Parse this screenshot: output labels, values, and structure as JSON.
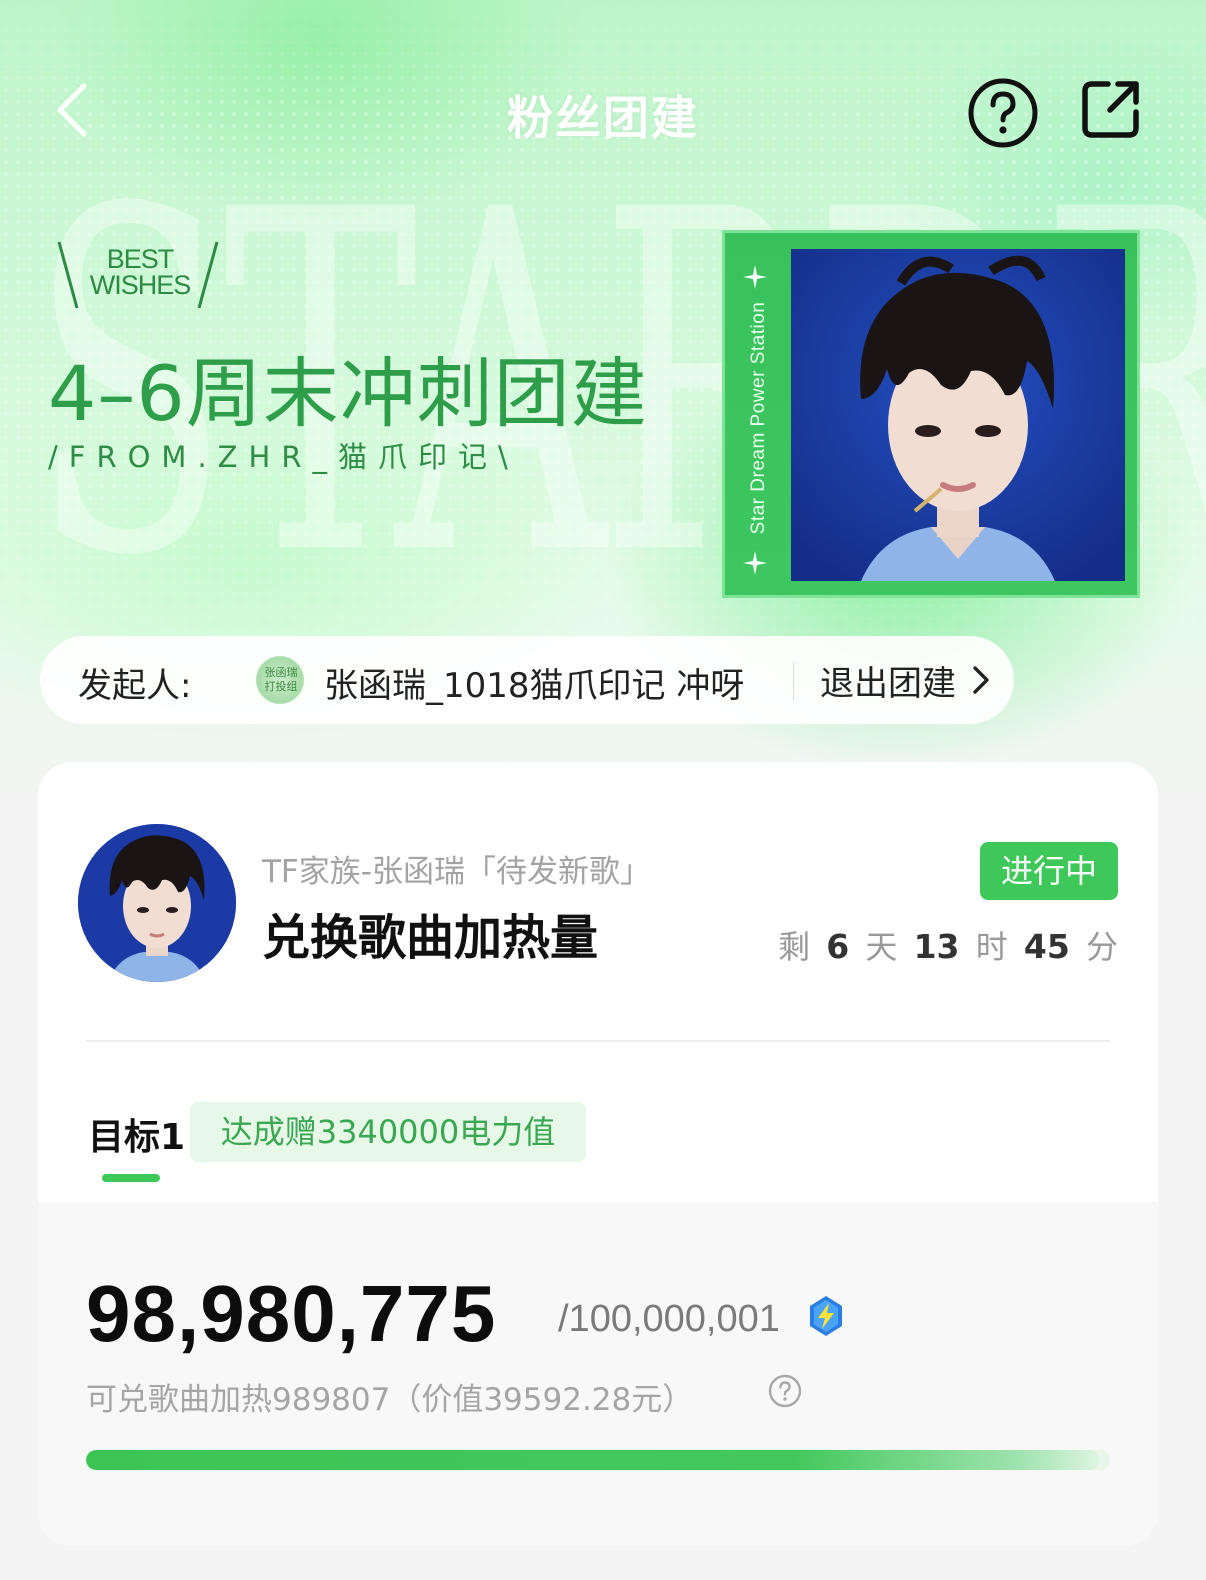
{
  "nav": {
    "title": "粉丝团建"
  },
  "hero": {
    "badge_line1": "BEST",
    "badge_line2": "WISHES",
    "watermark": "STARDREAM",
    "event_title": "4–6周末冲刺团建",
    "event_subtitle": "/FROM.ZHR_猫爪印记\\",
    "photo_label": "Star Dream Power Station"
  },
  "initiator": {
    "label": "发起人:",
    "avatar_text_line1": "张函瑞",
    "avatar_text_line2": "打投组",
    "name": "张函瑞_1018猫爪印记 冲呀",
    "exit_label": "退出团建"
  },
  "task": {
    "artist": "TF家族-张函瑞「待发新歌」",
    "title": "兑换歌曲加热量",
    "status": "进行中",
    "countdown": {
      "prefix": "剩",
      "days": "6",
      "days_unit": "天",
      "hours": "13",
      "hours_unit": "时",
      "minutes": "45",
      "minutes_unit": "分"
    }
  },
  "goal": {
    "tab_label": "目标1",
    "reward": "达成赠3340000电力值",
    "current": "98,980,775",
    "target": "/100,000,001",
    "progress_fraction": 0.9898,
    "redeem_text": "可兑歌曲加热989807（价值39592.28元）"
  },
  "colors": {
    "accent_green": "#3ec85a",
    "title_green": "#2f9e4a",
    "power_blue": "#2a7de1"
  },
  "icons": {
    "back": "chevron-left-icon",
    "help": "question-circle-icon",
    "share": "share-external-icon",
    "exit": "chevron-right-icon",
    "power": "lightning-badge-icon"
  }
}
